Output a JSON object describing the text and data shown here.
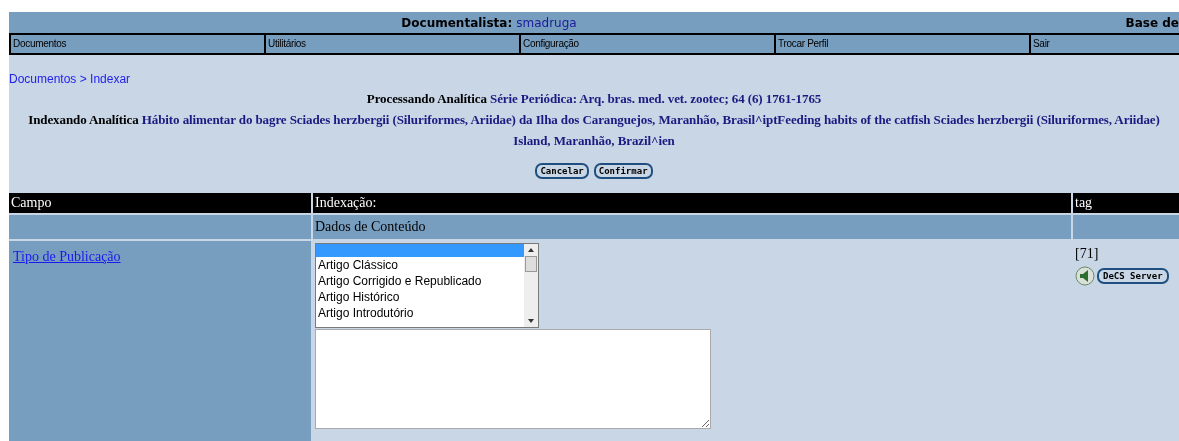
{
  "header": {
    "label": "Documentalista:",
    "user": "smadruga",
    "base_label": "Base de"
  },
  "menu": [
    {
      "label": "Documentos"
    },
    {
      "label": "Utilitários"
    },
    {
      "label": "Configuração"
    },
    {
      "label": "Trocar Perfil"
    },
    {
      "label": "Sair"
    }
  ],
  "breadcrumb": "Documentos > Indexar",
  "processing": {
    "label": "Processando Analítica",
    "value": "Série Periódica: Arq. bras. med. vet. zootec; 64 (6) 1761-1765"
  },
  "indexing": {
    "label": "Indexando Analítica",
    "lines": [
      "Hábito alimentar do bagre Sciades herzbergii (Siluriformes, Ariidae) da Ilha dos Caranguejos, Maranhão, Brasil^iptFeeding habits of the catfish Sciades herzbergii (Siluriformes, Ariidae)",
      "Island, Maranhão, Brazil^ien"
    ]
  },
  "actions": [
    "Cancelar",
    "Confirmar"
  ],
  "table": {
    "columns": [
      "Campo",
      "Indexação:",
      "tag"
    ],
    "section": "Dados de Conteúdo",
    "rows": [
      {
        "field": "Tipo de Publicação",
        "tag": "[71]",
        "decs_button": "DeCS Server",
        "listbox": {
          "blank_option_selected": true,
          "options": [
            {
              "label": "Artigo Clássico",
              "selected": false
            },
            {
              "label": "Artigo Corrigido e Republicado",
              "selected": false
            },
            {
              "label": "Artigo Histórico",
              "selected": false
            },
            {
              "label": "Artigo Introdutório",
              "selected": false
            }
          ]
        }
      }
    ]
  }
}
